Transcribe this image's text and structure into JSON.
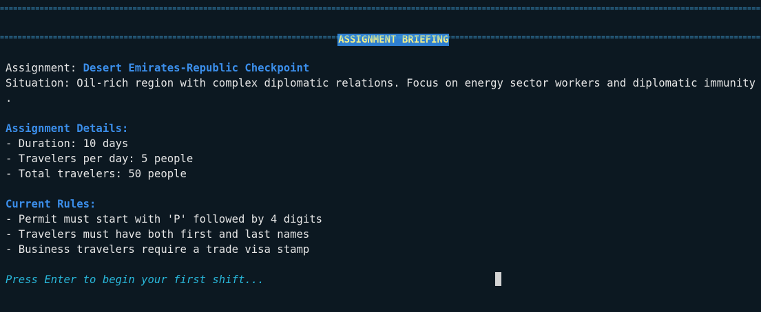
{
  "header": {
    "rule_top": "=======================================================================================================================================================================================================",
    "title": "ASSIGNMENT BRIEFING",
    "rule_bottom": "======================================================================================================================================================================================================="
  },
  "assignment": {
    "label": "Assignment: ",
    "name": "Desert Emirates-Republic Checkpoint"
  },
  "situation": {
    "text": "Situation: Oil-rich region with complex diplomatic relations. Focus on energy sector workers and diplomatic immunity abuse",
    "wrap": "."
  },
  "details": {
    "heading": "Assignment Details:",
    "items": [
      "- Duration: 10 days",
      "- Travelers per day: 5 people",
      "- Total travelers: 50 people"
    ]
  },
  "rules": {
    "heading": "Current Rules:",
    "items": [
      "- Permit must start with 'P' followed by 4 digits",
      "- Travelers must have both first and last names",
      "- Business travelers require a trade visa stamp"
    ]
  },
  "prompt": {
    "text": "Press Enter to begin your first shift..."
  }
}
